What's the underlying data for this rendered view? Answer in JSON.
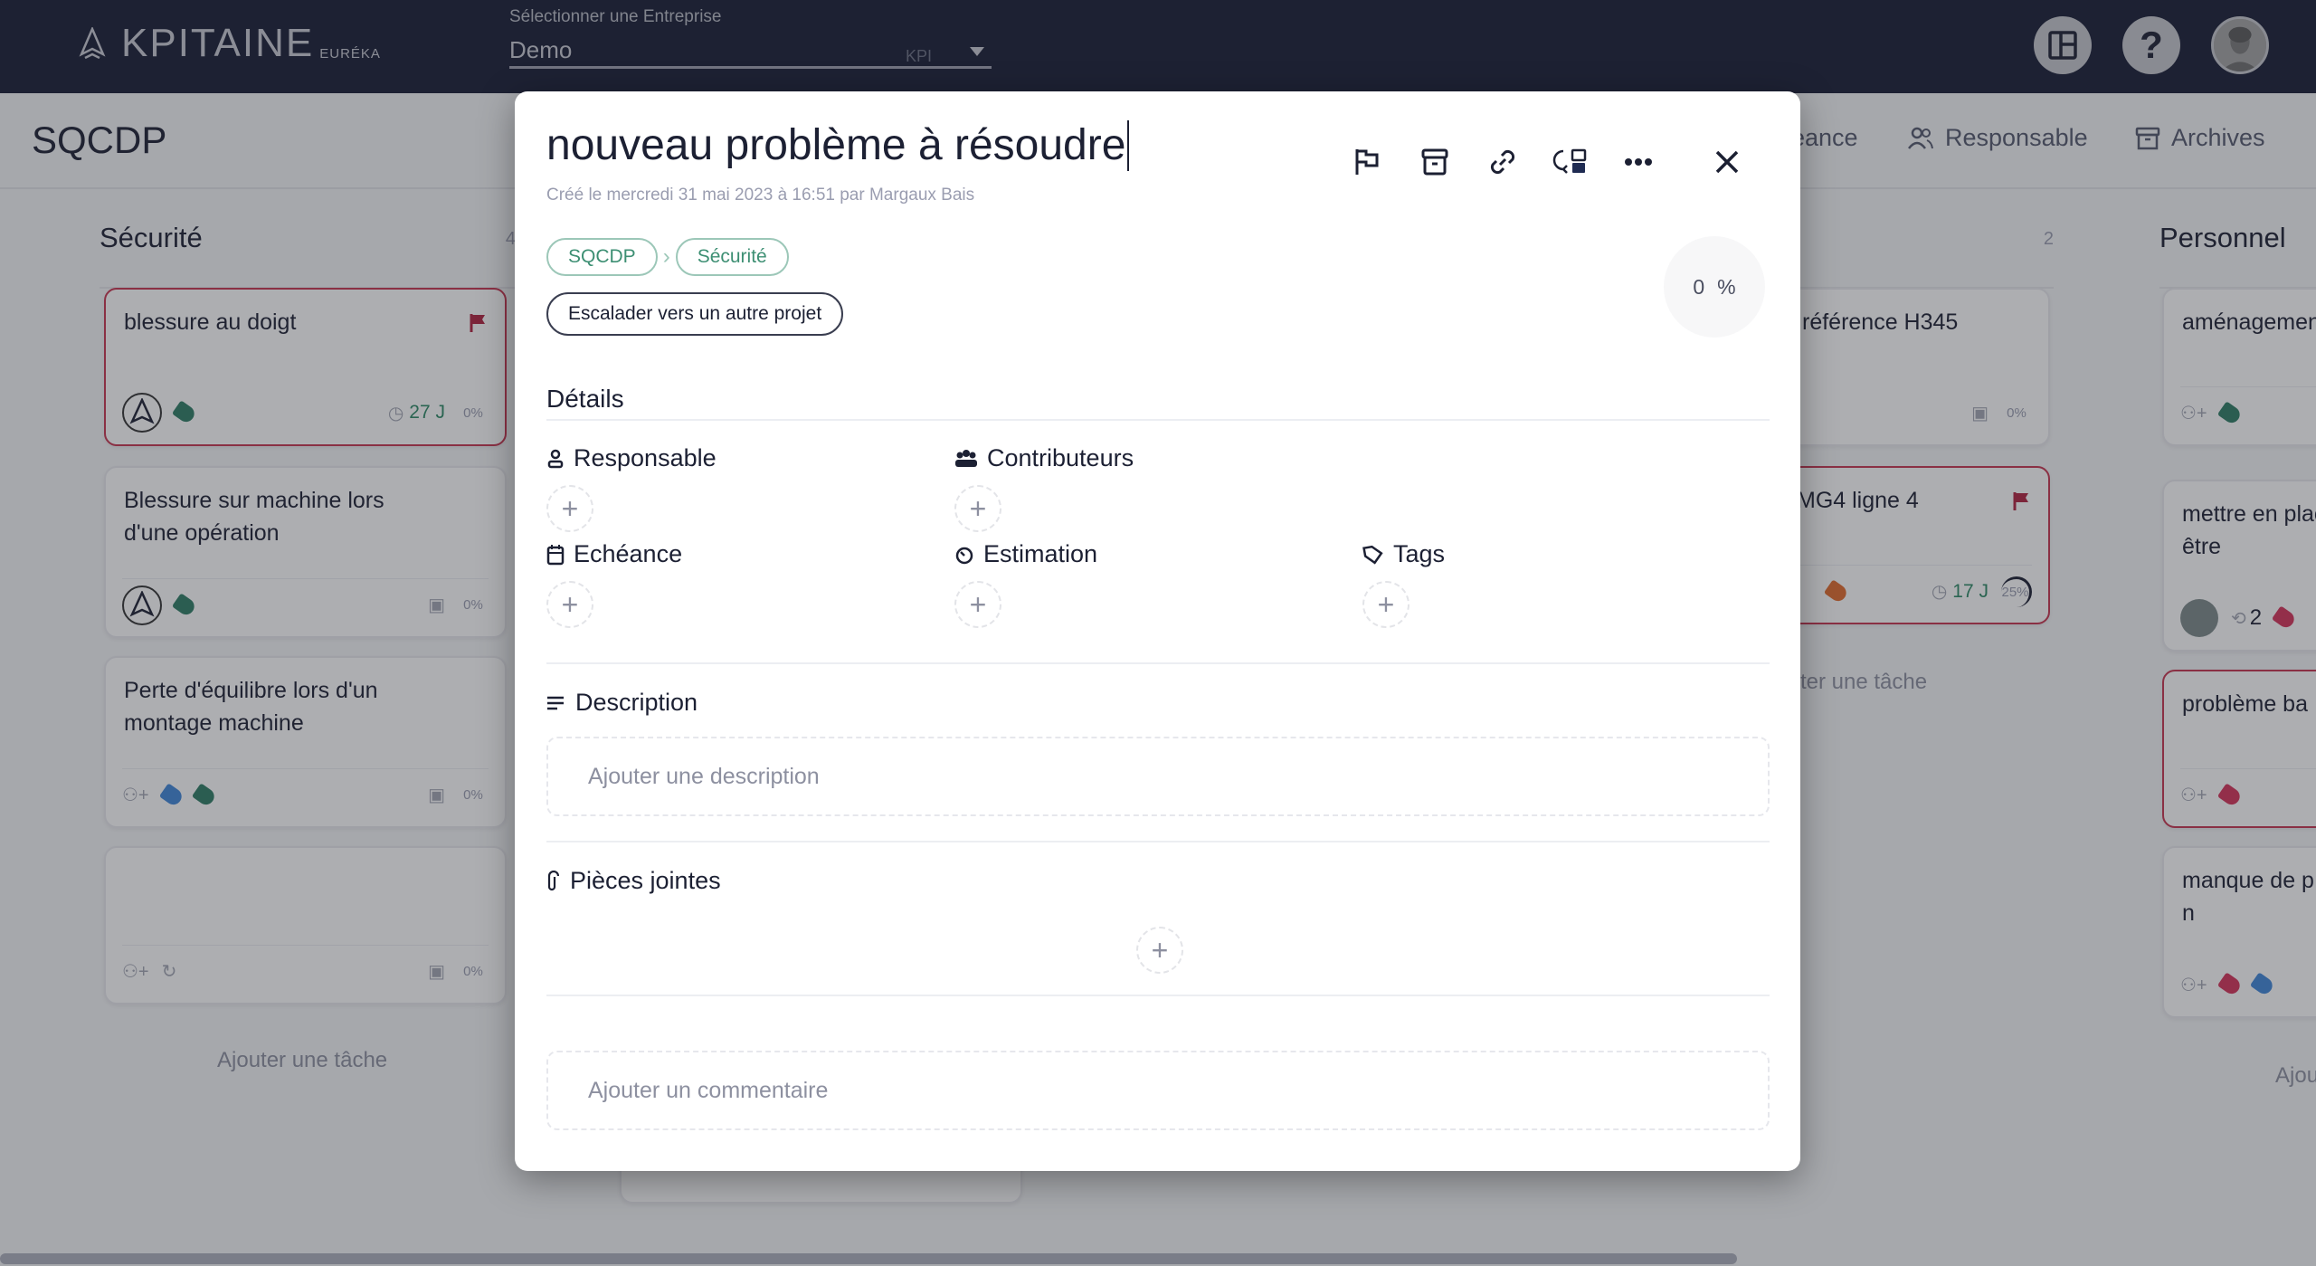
{
  "app": {
    "logo_text": "KPITAINE",
    "logo_sub": "EURÉKA",
    "company_selector": {
      "label": "Sélectionner une Entreprise",
      "value": "Demo",
      "suffix": "KPI"
    }
  },
  "header_buttons": [
    {
      "name": "layout-icon"
    },
    {
      "name": "help-icon",
      "label": "?"
    },
    {
      "name": "user-avatar"
    }
  ],
  "board": {
    "title": "SQCDP",
    "view_tabs": [
      {
        "label": "Echéance",
        "visible_text": "eance"
      },
      {
        "label": "Responsable"
      },
      {
        "label": "Archives"
      }
    ],
    "columns": [
      {
        "title": "Sécurité",
        "count": "4",
        "cards": [
          {
            "title": "blessure au doigt",
            "flagged": true,
            "assignee": "logo-avatar",
            "tags": [
              "#2e7d64"
            ],
            "days": "27 J",
            "progress": "0%"
          },
          {
            "title": "Blessure sur machine lors d'une opération",
            "flagged": false,
            "assignee": "logo-avatar",
            "tags": [
              "#2e7d64"
            ],
            "progress": "0%"
          },
          {
            "title": "Perte d'équilibre lors d'un montage machine",
            "flagged": false,
            "assignee": null,
            "tags": [
              "#3f86d9",
              "#2e7d64"
            ],
            "progress": "0%"
          },
          {
            "title": "",
            "flagged": false,
            "assignee": null,
            "tags": [],
            "progress": "0%"
          }
        ],
        "add_task": "Ajouter une tâche"
      },
      {
        "title": "",
        "count": "2",
        "cards": [
          {
            "title": "référence H345",
            "flagged": false,
            "progress": "0%"
          },
          {
            "title": "MG4 ligne 4",
            "flagged": true,
            "tags": [
              "#e36b2c"
            ],
            "days": "17 J",
            "progress": "25%"
          }
        ],
        "add_task": "ter une tâche"
      },
      {
        "title": "Personnel",
        "cards": [
          {
            "title": "aménagement préventif",
            "tags": [
              "#2e7d64"
            ]
          },
          {
            "title": "mettre en place de bien être",
            "subtasks": "2",
            "tags": [
              "#d6335a"
            ]
          },
          {
            "title": "problème ba",
            "flagged": true,
            "tags": [
              "#d6335a"
            ]
          },
          {
            "title": "manque de p l'équipe de n",
            "tags": [
              "#d6335a",
              "#3f86d9"
            ]
          }
        ],
        "add_task": "Ajou"
      }
    ]
  },
  "modal": {
    "title": "nouveau problème à résoudre",
    "meta": "Créé le  mercredi 31 mai 2023  à  16:51  par  Margaux Bais",
    "toolbar": [
      "flag-icon",
      "archive-icon",
      "link-icon",
      "convert-subtask-icon",
      "more-icon"
    ],
    "breadcrumb": [
      "SQCDP",
      "Sécurité"
    ],
    "escalate_label": "Escalader vers un autre projet",
    "progress": {
      "value": "0",
      "unit": "%"
    },
    "details_title": "Détails",
    "fields": {
      "responsable": "Responsable",
      "contributeurs": "Contributeurs",
      "echeance": "Echéance",
      "estimation": "Estimation",
      "tags": "Tags"
    },
    "description": {
      "title": "Description",
      "placeholder": "Ajouter une description"
    },
    "attachments": {
      "title": "Pièces jointes"
    },
    "comment": {
      "placeholder": "Ajouter un commentaire"
    }
  }
}
